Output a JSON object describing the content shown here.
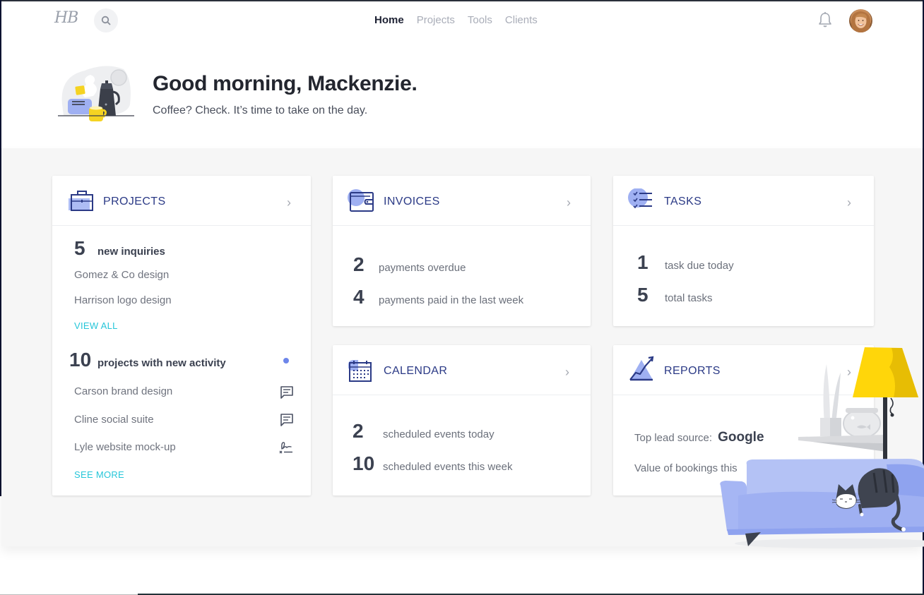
{
  "nav": {
    "logo": "HB",
    "search_icon": "search-icon",
    "links": [
      {
        "label": "Home",
        "active": true
      },
      {
        "label": "Projects",
        "active": false
      },
      {
        "label": "Tools",
        "active": false
      },
      {
        "label": "Clients",
        "active": false
      }
    ],
    "bell_icon": "bell-icon",
    "avatar": "user-avatar"
  },
  "greeting": {
    "title": "Good morning, Mackenzie.",
    "subtitle": "Coffee? Check. It’s time to take on the day."
  },
  "cards": {
    "projects": {
      "title": "PROJECTS",
      "icon": "briefcase-icon",
      "inquiries": {
        "count": "5",
        "label": "new inquiries",
        "items": [
          "Gomez & Co design",
          "Harrison logo design"
        ],
        "link": "VIEW ALL"
      },
      "activity": {
        "count": "10",
        "label": "projects with new activity",
        "items": [
          {
            "name": "Carson brand design",
            "icon": "message-icon"
          },
          {
            "name": "Cline social suite",
            "icon": "message-icon"
          },
          {
            "name": "Lyle website mock-up",
            "icon": "signature-icon"
          }
        ],
        "link": "SEE MORE"
      }
    },
    "invoices": {
      "title": "INVOICES",
      "icon": "wallet-icon",
      "stats": [
        {
          "num": "2",
          "label": "payments overdue"
        },
        {
          "num": "4",
          "label": "payments paid in the last week"
        }
      ]
    },
    "tasks": {
      "title": "TASKS",
      "icon": "checklist-icon",
      "stats": [
        {
          "num": "1",
          "label": "task due today"
        },
        {
          "num": "5",
          "label": "total tasks"
        }
      ]
    },
    "calendar": {
      "title": "CALENDAR",
      "icon": "calendar-icon",
      "stats": [
        {
          "num": "2",
          "label": "scheduled events today"
        },
        {
          "num": "10",
          "label": "scheduled events this week"
        }
      ]
    },
    "reports": {
      "title": "REPORTS",
      "icon": "chart-trend-icon",
      "top_lead_label": "Top lead source:",
      "top_lead_value": "Google",
      "bookings_label": "Value of bookings this"
    }
  },
  "colors": {
    "accent_navy": "#2b3a86",
    "accent_periwinkle": "#9fb0f2",
    "link_teal": "#26c6d9",
    "lamp_yellow": "#ffd60a"
  }
}
